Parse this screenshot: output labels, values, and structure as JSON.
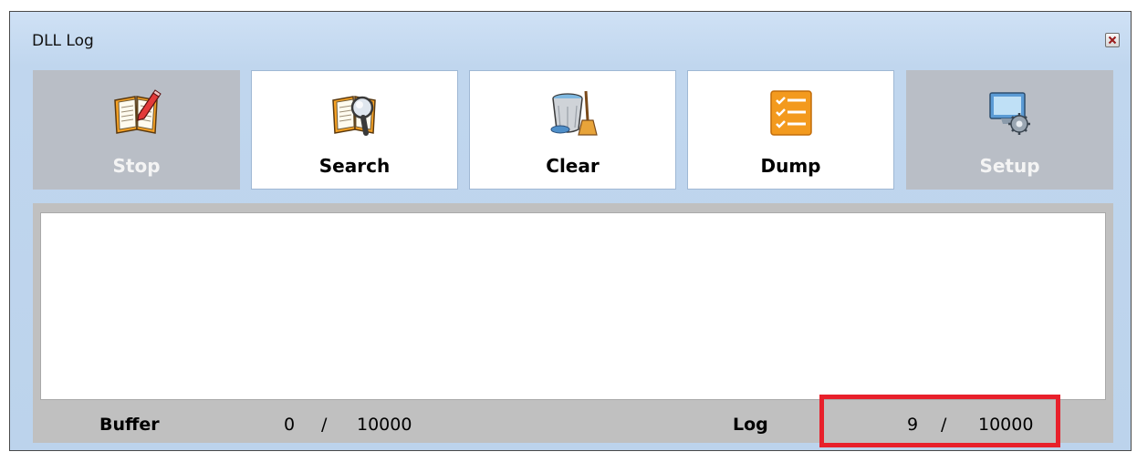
{
  "window": {
    "title": "DLL Log"
  },
  "toolbar": {
    "buttons": [
      {
        "label": "Stop",
        "enabled": false,
        "icon": "book-pencil-icon"
      },
      {
        "label": "Search",
        "enabled": true,
        "icon": "book-magnifier-icon"
      },
      {
        "label": "Clear",
        "enabled": true,
        "icon": "trash-bin-broom-icon"
      },
      {
        "label": "Dump",
        "enabled": true,
        "icon": "checklist-icon"
      },
      {
        "label": "Setup",
        "enabled": false,
        "icon": "monitor-gear-icon"
      }
    ]
  },
  "status": {
    "buffer_label": "Buffer",
    "buffer_count": "0",
    "buffer_sep": "/",
    "buffer_max": "10000",
    "log_label": "Log",
    "log_count": "9",
    "log_sep": "/",
    "log_max": "10000"
  },
  "colors": {
    "highlight": "#e8202b",
    "disabled_button": "#b9bec6",
    "dump_orange": "#f39a1e"
  }
}
